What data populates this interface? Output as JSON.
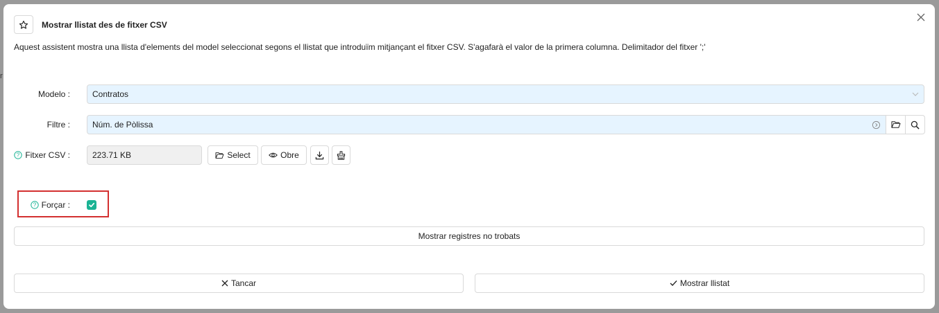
{
  "background": {
    "stub_text": "r"
  },
  "dialog": {
    "title": "Mostrar llistat des de fitxer CSV",
    "description": "Aquest assistent mostra una llista d'elements del model seleccionat segons el llistat que introduïm mitjançant el fitxer CSV. S'agafarà el valor de la primera columna. Delimitador del fitxer ';'"
  },
  "form": {
    "model": {
      "label": "Modelo :",
      "value": "Contratos"
    },
    "filter": {
      "label": "Filtre :",
      "value": "Núm. de Pòlissa"
    },
    "csv": {
      "label": "Fitxer CSV :",
      "value": "223.71 KB",
      "select_label": "Select",
      "open_label": "Obre"
    },
    "force": {
      "label": "Forçar :",
      "checked": true
    }
  },
  "buttons": {
    "show_not_found": "Mostrar registres no trobats",
    "cancel": "Tancar",
    "show_list": "Mostrar llistat"
  },
  "colors": {
    "accent": "#1ab394",
    "field_bg": "#e6f4ff",
    "highlight": "#d32f2f"
  }
}
